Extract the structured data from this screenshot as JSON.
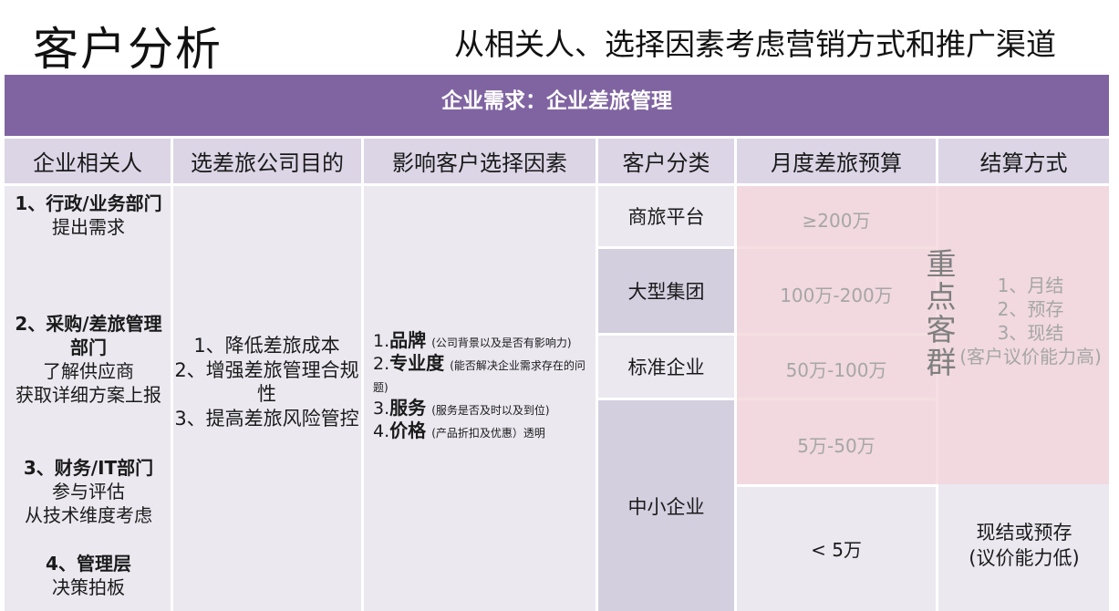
{
  "header": {
    "title": "客户分析",
    "subtitle": "从相关人、选择因素考虑营销方式和推广渠道"
  },
  "banner": {
    "text": "企业需求：企业差旅管理"
  },
  "columns": [
    "企业相关人",
    "选差旅公司目的",
    "影响客户选择因素",
    "客户分类",
    "月度差旅预算",
    "结算方式"
  ],
  "stakeholders": [
    {
      "title": "1、行政/业务部门",
      "lines": [
        "提出需求"
      ]
    },
    {
      "title": "2、采购/差旅管理部门",
      "lines": [
        "了解供应商",
        "获取详细方案上报"
      ]
    },
    {
      "title": "3、财务/IT部门",
      "lines": [
        "参与评估",
        "从技术维度考虑"
      ]
    },
    {
      "title": "4、管理层",
      "lines": [
        "决策拍板"
      ]
    }
  ],
  "purposes": [
    "1、降低差旅成本",
    "2、增强差旅管理合规性",
    "3、提高差旅风险管控"
  ],
  "factors": [
    {
      "num": "1.",
      "name": "品牌",
      "note": "(公司背景以及是否有影响力)"
    },
    {
      "num": "2.",
      "name": "专业度",
      "note": "(能否解决企业需求存在的问题)"
    },
    {
      "num": "3.",
      "name": "服务",
      "note": "(服务是否及时以及到位)"
    },
    {
      "num": "4.",
      "name": "价格",
      "note": "(产品折扣及优惠）透明"
    }
  ],
  "categories": [
    "商旅平台",
    "大型集团",
    "标准企业",
    "中小企业"
  ],
  "budgets": [
    "≥200万",
    "100万-200万",
    "50万-100万",
    "5万-50万",
    "< 5万"
  ],
  "key_label": "重点客群",
  "settlement": {
    "large": [
      "1、月结",
      "2、预存",
      "3、现结",
      "(客户议价能力高)"
    ],
    "small": [
      "现结或预存",
      "(议价能力低)"
    ]
  },
  "colors": {
    "banner": "#8064a2",
    "header_bg": "#dcd5e6",
    "cell_bg": "#ebe8f0",
    "highlight": "#f2d2d8"
  }
}
